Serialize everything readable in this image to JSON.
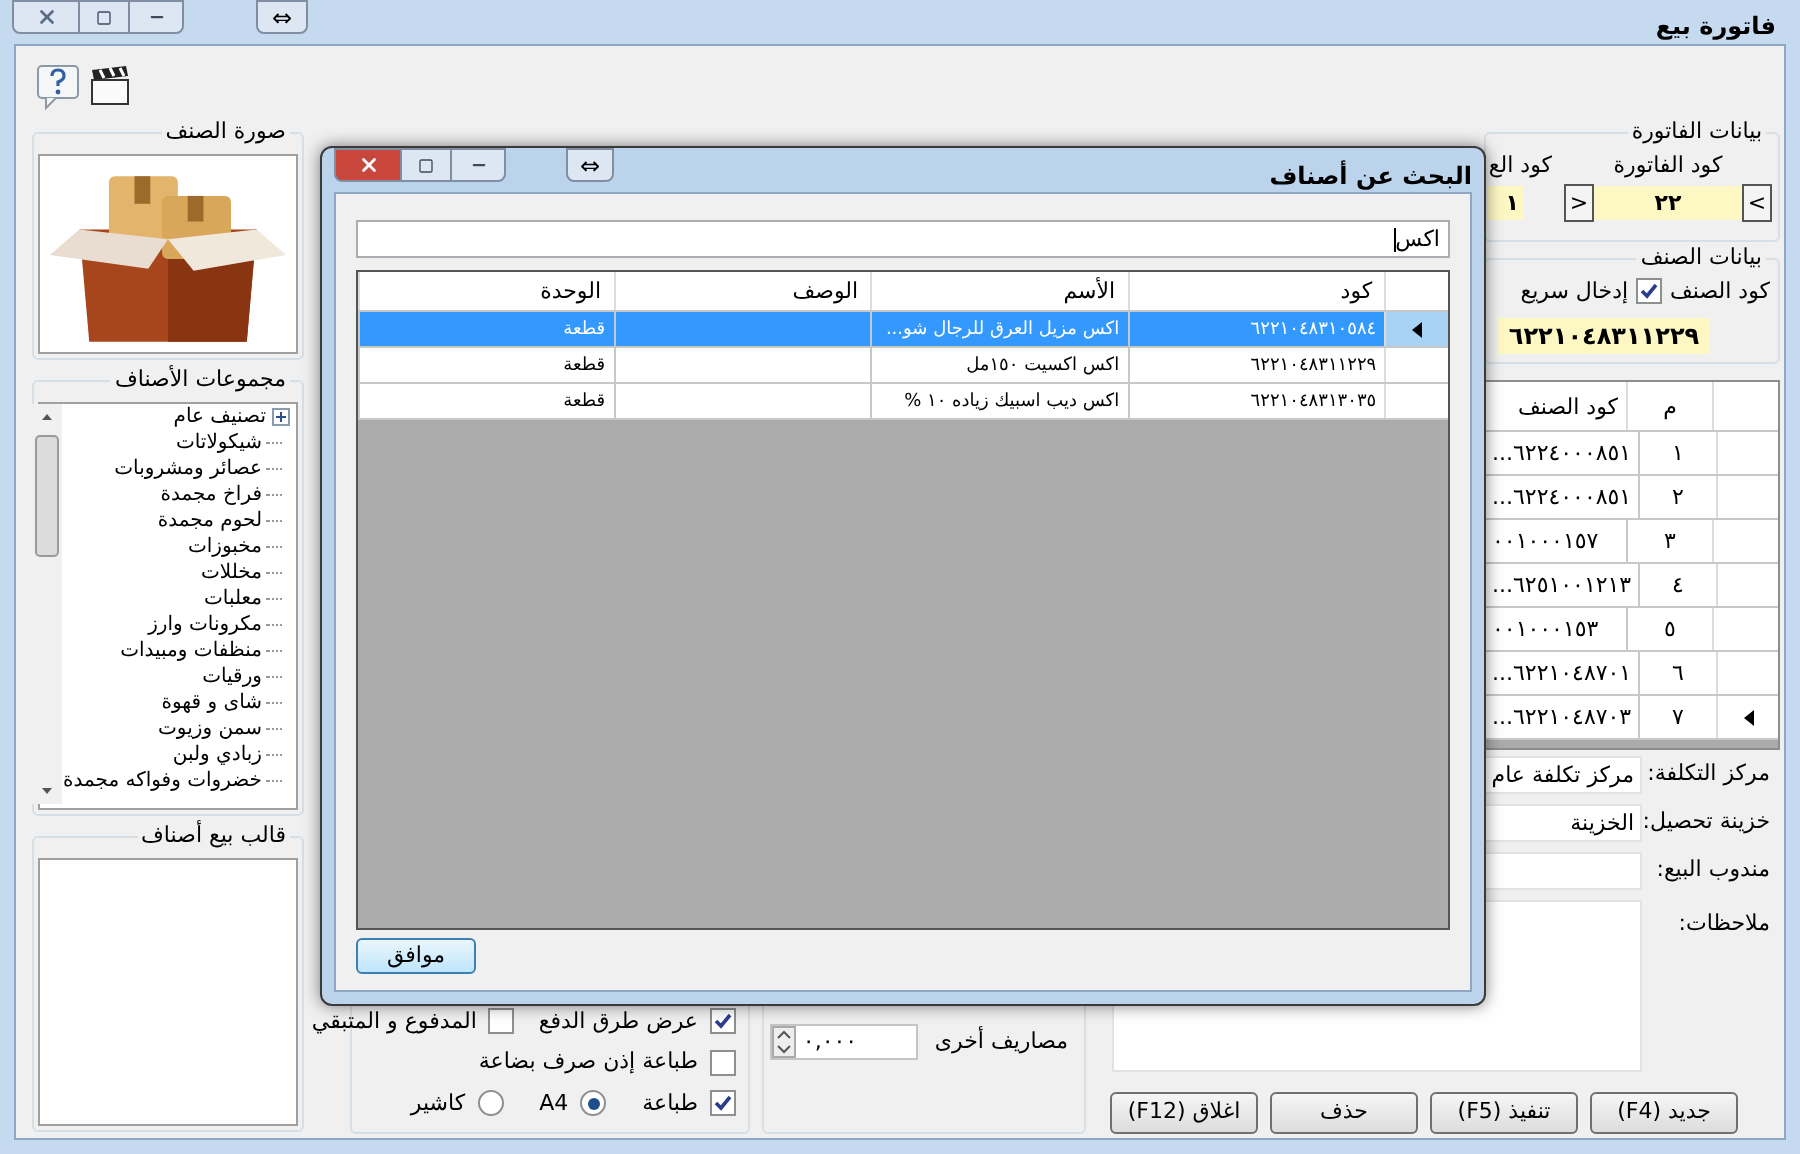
{
  "window": {
    "title": "فاتورة بيع",
    "swap_button": "⇔"
  },
  "item_image": {
    "title": "صورة الصنف",
    "kind": "picture"
  },
  "groups": {
    "title": "مجموعات الأصناف",
    "tree": [
      {
        "label": "تصنيف عام",
        "children": [
          {
            "label": "شيكولاتات"
          },
          {
            "label": "عصائر ومشروبات"
          },
          {
            "label": "فراخ مجمدة"
          },
          {
            "label": "لحوم مجمدة"
          },
          {
            "label": "مخبوزات"
          },
          {
            "label": "مخللات"
          },
          {
            "label": "معلبات"
          },
          {
            "label": "مكرونات وارز"
          },
          {
            "label": "منظفات ومبيدات"
          },
          {
            "label": "ورقيات"
          },
          {
            "label": "شاى و قهوة"
          },
          {
            "label": "سمن وزيوت"
          },
          {
            "label": "زبادي ولبن"
          },
          {
            "label": "خضروات وفواكه مجمدة"
          }
        ]
      }
    ]
  },
  "sale_template": {
    "title": "قالب بيع أصناف"
  },
  "invoice_data": {
    "title": "بيانات الفاتورة",
    "code_label": "كود الفاتورة",
    "code": "٢٢",
    "next": ">",
    "prev": "<",
    "second_label": "كود الع",
    "second_value": "١"
  },
  "item_data": {
    "title": "بيانات الصنف",
    "code_label": "كود الصنف",
    "quick_entry": {
      "label": "إدخال سريع",
      "checked": true
    },
    "code": "٦٢٢١٠٤٨٣١١٢٢٩"
  },
  "invoice_grid": {
    "columns": [
      "م",
      "كود الصنف"
    ],
    "rows": [
      {
        "number": "١",
        "code": "٦٢٢٤٠٠٠٨٥١...",
        "current": false
      },
      {
        "number": "٢",
        "code": "٦٢٢٤٠٠٠٨٥١...",
        "current": false
      },
      {
        "number": "٣",
        "code": "٠٠١٠٠٠١٥٧",
        "current": false
      },
      {
        "number": "٤",
        "code": "٦٢٥١٠٠١٢١٣...",
        "current": false
      },
      {
        "number": "٥",
        "code": "٠٠١٠٠٠١٥٣",
        "current": false
      },
      {
        "number": "٦",
        "code": "٦٢٢١٠٤٨٧٠١...",
        "current": false
      },
      {
        "number": "٧",
        "code": "٦٢٢١٠٤٨٧٠٣...",
        "current": true
      }
    ]
  },
  "fields": [
    {
      "label": "مركز التكلفة:",
      "value": "مركز تكلفة عام"
    },
    {
      "label": "خزينة تحصيل:",
      "value": "الخزينة"
    },
    {
      "label": "مندوب البيع:"
    }
  ],
  "notes_label": "ملاحظات:",
  "buttons": [
    "جديد (F4)",
    "تنفيذ (F5)",
    "حذف",
    "اغلاق (F12)"
  ],
  "other_expenses": {
    "label": "مصاريف أخرى",
    "value": "٠,٠٠٠"
  },
  "options": {
    "show_payment_methods": {
      "label": "عرض طرق الدفع",
      "checked": true
    },
    "paid_remaining": {
      "label": "المدفوع و المتبقي",
      "checked": false
    },
    "print_issue_permit": {
      "label": "طباعة إذن صرف بضاعة",
      "checked": false
    },
    "print": {
      "label": "طباعة",
      "checked": true
    },
    "paper": [
      {
        "label": "A4",
        "selected": true
      },
      {
        "label": "كاشير",
        "selected": false
      }
    ]
  },
  "dialog": {
    "title": "البحث عن أصناف",
    "swap_button": "⇔",
    "search": "اكس",
    "columns": [
      "كود",
      "الأسم",
      "الوصف",
      "الوحدة"
    ],
    "rows": [
      {
        "code": "٦٢٢١٠٤٨٣١٠٥٨٤",
        "name": "اكس مزيل العرق للرجال شو...",
        "unit": "قطعة",
        "selected": true
      },
      {
        "code": "٦٢٢١٠٤٨٣١١٢٢٩",
        "name": "اكس اكسيت ١٥٠مل",
        "unit": "قطعة",
        "selected": false
      },
      {
        "code": "٦٢٢١٠٤٨٣١٣٠٣٥",
        "name": "اكس ديب اسبيك زياده ١٠ %",
        "unit": "قطعة",
        "selected": false
      }
    ],
    "ok_button": "موافق"
  }
}
